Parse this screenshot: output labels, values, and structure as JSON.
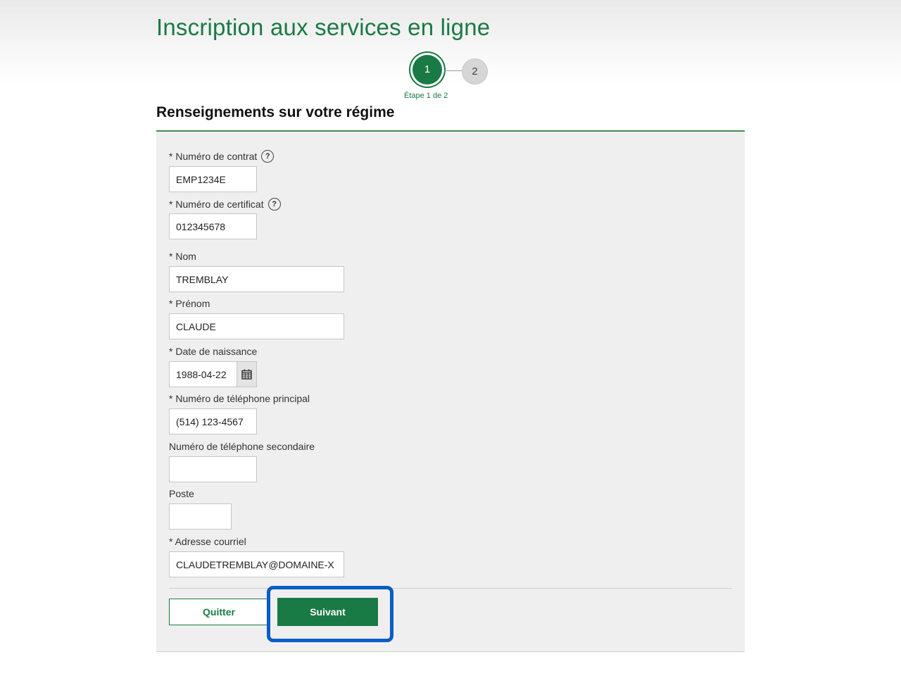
{
  "page": {
    "title": "Inscription aux services en ligne",
    "section_title": "Renseignements sur votre régime"
  },
  "stepper": {
    "current": "1",
    "next": "2",
    "caption": "Étape 1 de 2"
  },
  "form": {
    "contract": {
      "label": "* Numéro de contrat",
      "value": "EMP1234E"
    },
    "certificate": {
      "label": "* Numéro de certificat",
      "value": "012345678"
    },
    "last_name": {
      "label": "* Nom",
      "value": "TREMBLAY"
    },
    "first_name": {
      "label": "* Prénom",
      "value": "CLAUDE"
    },
    "birth_date": {
      "label": "* Date de naissance",
      "value": "1988-04-22"
    },
    "phone_main": {
      "label": "* Numéro de téléphone principal",
      "value": "(514) 123-4567"
    },
    "phone_secondary": {
      "label": "Numéro de téléphone secondaire",
      "value": ""
    },
    "extension": {
      "label": "Poste",
      "value": ""
    },
    "email": {
      "label": "* Adresse courriel",
      "value": "CLAUDETREMBLAY@DOMAINE-X"
    }
  },
  "buttons": {
    "quit": "Quitter",
    "next": "Suivant"
  },
  "colors": {
    "brand_green": "#1a7a45",
    "focus_blue": "#0a5cc7",
    "panel_gray": "#efefef"
  },
  "icons": {
    "help": "help-circle-icon",
    "calendar": "calendar-icon"
  }
}
